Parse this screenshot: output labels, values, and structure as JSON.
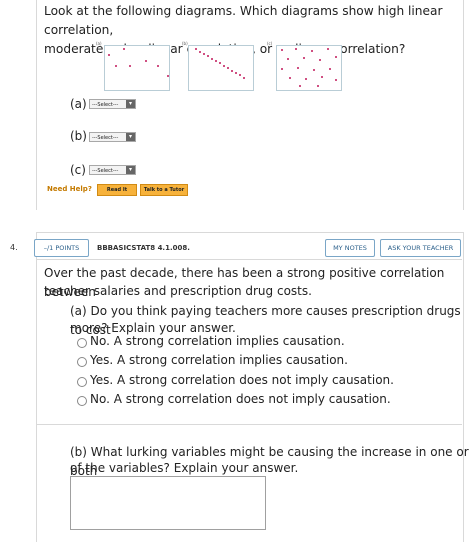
{
  "question3": {
    "text_line1": "Look at the following diagrams. Which diagrams show high linear correlation,",
    "text_line2": "moderate or low linear correlation, or no linear correlation?",
    "plot_labels": [
      "(a)",
      "(b)",
      "(c)"
    ],
    "parts": [
      {
        "label": "(a)",
        "select_value": "---Select---"
      },
      {
        "label": "(b)",
        "select_value": "---Select---"
      },
      {
        "label": "(c)",
        "select_value": "---Select---"
      }
    ],
    "need_help": "Need Help?",
    "read_it": "Read It",
    "talk_to_tutor": "Talk to a Tutor"
  },
  "question4": {
    "number": "4.",
    "points": "–/1 POINTS",
    "code": "BBBASICSTAT8 4.1.008.",
    "my_notes": "MY NOTES",
    "ask_teacher": "ASK YOUR TEACHER",
    "intro_line1": "Over the past decade, there has been a strong positive correlation between",
    "intro_line2": "teacher salaries and prescription drug costs.",
    "part_a_line1": "(a) Do you think paying teachers more causes prescription drugs to cost",
    "part_a_line2": "more? Explain your answer.",
    "options": [
      "No. A strong correlation implies causation.",
      "Yes. A strong correlation implies causation.",
      "Yes. A strong correlation does not imply causation.",
      "No. A strong correlation does not imply causation."
    ],
    "part_b_line1": "(b) What lurking variables might be causing the increase in one or both",
    "part_b_line2": "of the variables? Explain your answer."
  },
  "colors": {
    "dot": "#c2185b",
    "accent_button": "#f7b23b",
    "link_blue": "#2a5f8a"
  }
}
